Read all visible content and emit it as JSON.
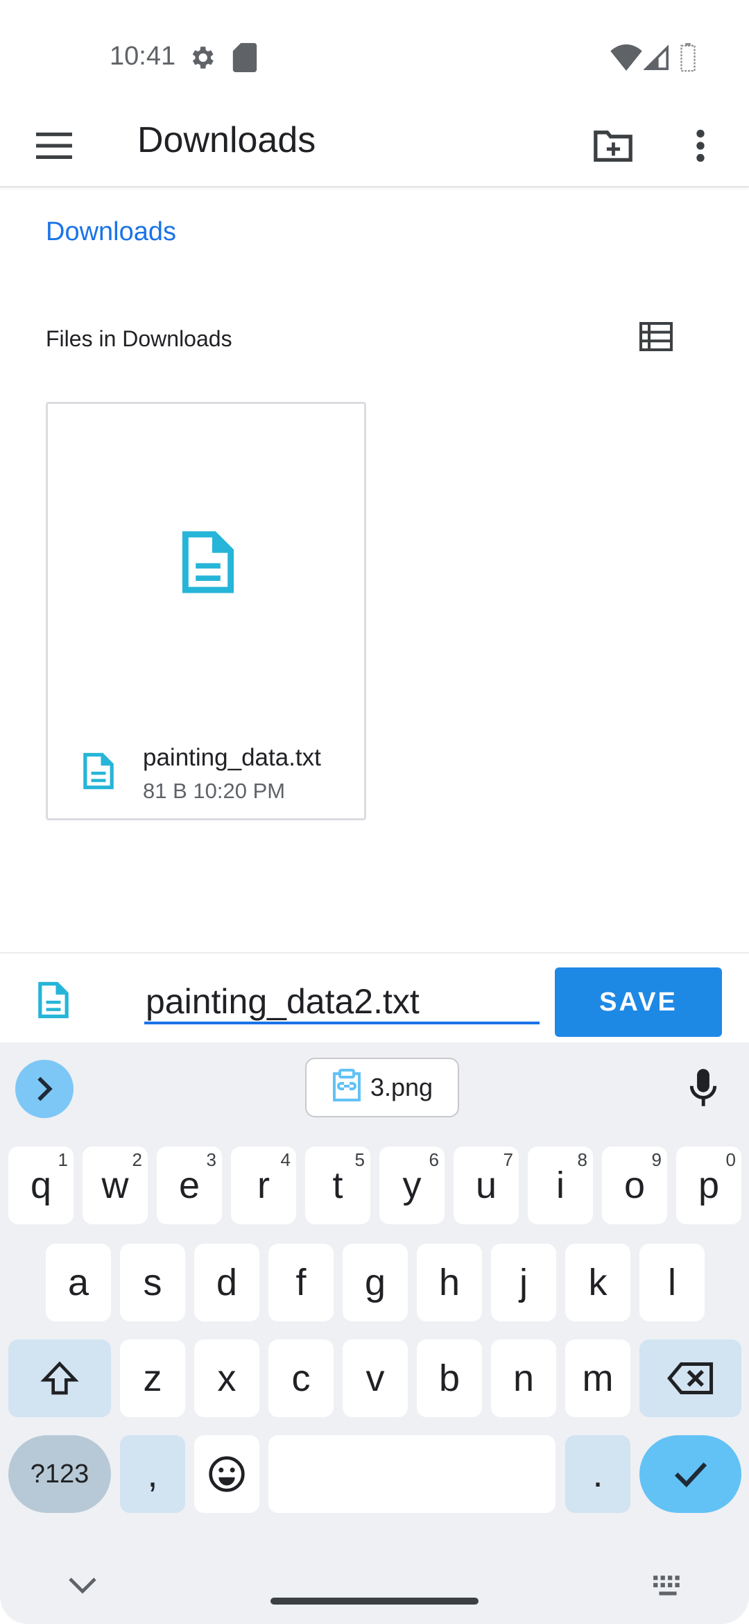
{
  "status": {
    "time": "10:41",
    "icons": [
      "settings-icon",
      "sd-card-icon",
      "wifi-icon",
      "cell-signal-icon",
      "battery-icon"
    ]
  },
  "app_bar": {
    "title": "Downloads",
    "icons": [
      "menu-icon",
      "new-folder-icon",
      "more-options-icon"
    ]
  },
  "breadcrumb": "Downloads",
  "section": {
    "title": "Files in Downloads",
    "view_toggle_icon": "list-view-icon"
  },
  "files": [
    {
      "name": "painting_data.txt",
      "meta": "81 B 10:20 PM",
      "icon": "document-icon"
    }
  ],
  "save_bar": {
    "filename": "painting_data2.txt",
    "save_label": "SAVE",
    "icon": "document-icon"
  },
  "keyboard": {
    "clipboard_chip": "3.png",
    "row1": [
      {
        "k": "q",
        "h": "1"
      },
      {
        "k": "w",
        "h": "2"
      },
      {
        "k": "e",
        "h": "3"
      },
      {
        "k": "r",
        "h": "4"
      },
      {
        "k": "t",
        "h": "5"
      },
      {
        "k": "y",
        "h": "6"
      },
      {
        "k": "u",
        "h": "7"
      },
      {
        "k": "i",
        "h": "8"
      },
      {
        "k": "o",
        "h": "9"
      },
      {
        "k": "p",
        "h": "0"
      }
    ],
    "row2": [
      "a",
      "s",
      "d",
      "f",
      "g",
      "h",
      "j",
      "k",
      "l"
    ],
    "row3": [
      "z",
      "x",
      "c",
      "v",
      "b",
      "n",
      "m"
    ],
    "symbols_label": "?123",
    "comma": ",",
    "period": "."
  },
  "colors": {
    "accent": "#1a73e8",
    "save_button": "#1e88e5",
    "file_icon": "#26b5d8",
    "keyboard_bg": "#eef0f3"
  }
}
